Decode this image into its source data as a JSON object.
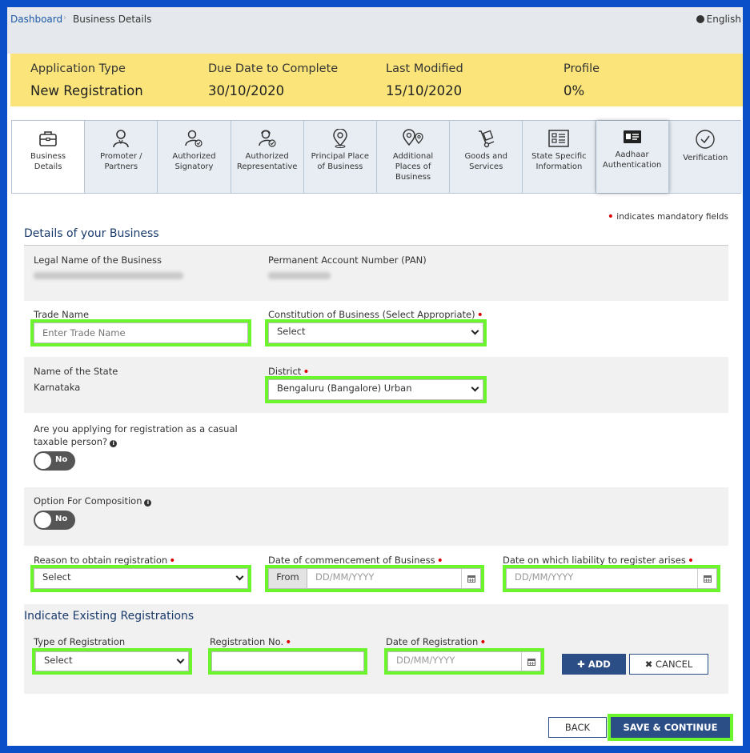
{
  "breadcrumb": {
    "home": "Dashboard",
    "current": "Business Details"
  },
  "language": "English",
  "application_info": [
    {
      "label": "Application Type",
      "value": "New Registration"
    },
    {
      "label": "Due Date to Complete",
      "value": "30/10/2020"
    },
    {
      "label": "Last Modified",
      "value": "15/10/2020"
    },
    {
      "label": "Profile",
      "value": "0%"
    }
  ],
  "tabs": [
    {
      "line1": "Business",
      "line2": "Details",
      "line3": "",
      "icon": "briefcase-icon"
    },
    {
      "line1": "Promoter /",
      "line2": "Partners",
      "line3": "",
      "icon": "promoter-icon"
    },
    {
      "line1": "Authorized",
      "line2": "Signatory",
      "line3": "",
      "icon": "signatory-icon"
    },
    {
      "line1": "Authorized",
      "line2": "Representative",
      "line3": "",
      "icon": "representative-icon"
    },
    {
      "line1": "Principal Place",
      "line2": "of Business",
      "line3": "",
      "icon": "location-pin-icon"
    },
    {
      "line1": "Additional",
      "line2": "Places of",
      "line3": "Business",
      "icon": "multi-location-icon"
    },
    {
      "line1": "Goods and",
      "line2": "Services",
      "line3": "",
      "icon": "hand-truck-icon"
    },
    {
      "line1": "State Specific",
      "line2": "Information",
      "line3": "",
      "icon": "info-list-icon"
    },
    {
      "line1": "Aadhaar",
      "line2": "Authentication",
      "line3": "",
      "icon": "id-card-icon"
    },
    {
      "line1": "Verification",
      "line2": "",
      "line3": "",
      "icon": "check-circle-icon"
    }
  ],
  "mandatory_note": "indicates mandatory fields",
  "business": {
    "section_title": "Details of your Business",
    "legal_name_label": "Legal Name of the Business",
    "pan_label": "Permanent Account Number (PAN)",
    "trade_name_label": "Trade Name",
    "trade_name_placeholder": "Enter Trade Name",
    "constitution_label": "Constitution of Business (Select Appropriate)",
    "constitution_value": "Select",
    "state_label": "Name of the State",
    "state_value": "Karnataka",
    "district_label": "District",
    "district_value": "Bengaluru (Bangalore) Urban",
    "casual_label_line1": "Are you applying for registration as a casual",
    "casual_label_line2": "taxable person?",
    "casual_toggle": "No",
    "composition_label": "Option For Composition",
    "composition_toggle": "No",
    "reason_label": "Reason to obtain registration",
    "reason_value": "Select",
    "commencement_label": "Date of commencement of Business",
    "commencement_addon": "From",
    "commencement_placeholder": "DD/MM/YYYY",
    "liability_label": "Date on which liability to register arises",
    "liability_placeholder": "DD/MM/YYYY"
  },
  "existing": {
    "section_title": "Indicate Existing Registrations",
    "type_label": "Type of Registration",
    "type_value": "Select",
    "regno_label": "Registration No.",
    "regno_value": "",
    "date_label": "Date of Registration",
    "date_placeholder": "DD/MM/YYYY",
    "add_label": "ADD",
    "cancel_label": "CANCEL"
  },
  "footer": {
    "back_label": "BACK",
    "save_label": "SAVE & CONTINUE"
  },
  "colors": {
    "accent": "#2c4e86",
    "highlight": "#6cf52d",
    "info_bar": "#fbe57b",
    "frame": "#0a4fc7",
    "required": "#dd0000"
  }
}
